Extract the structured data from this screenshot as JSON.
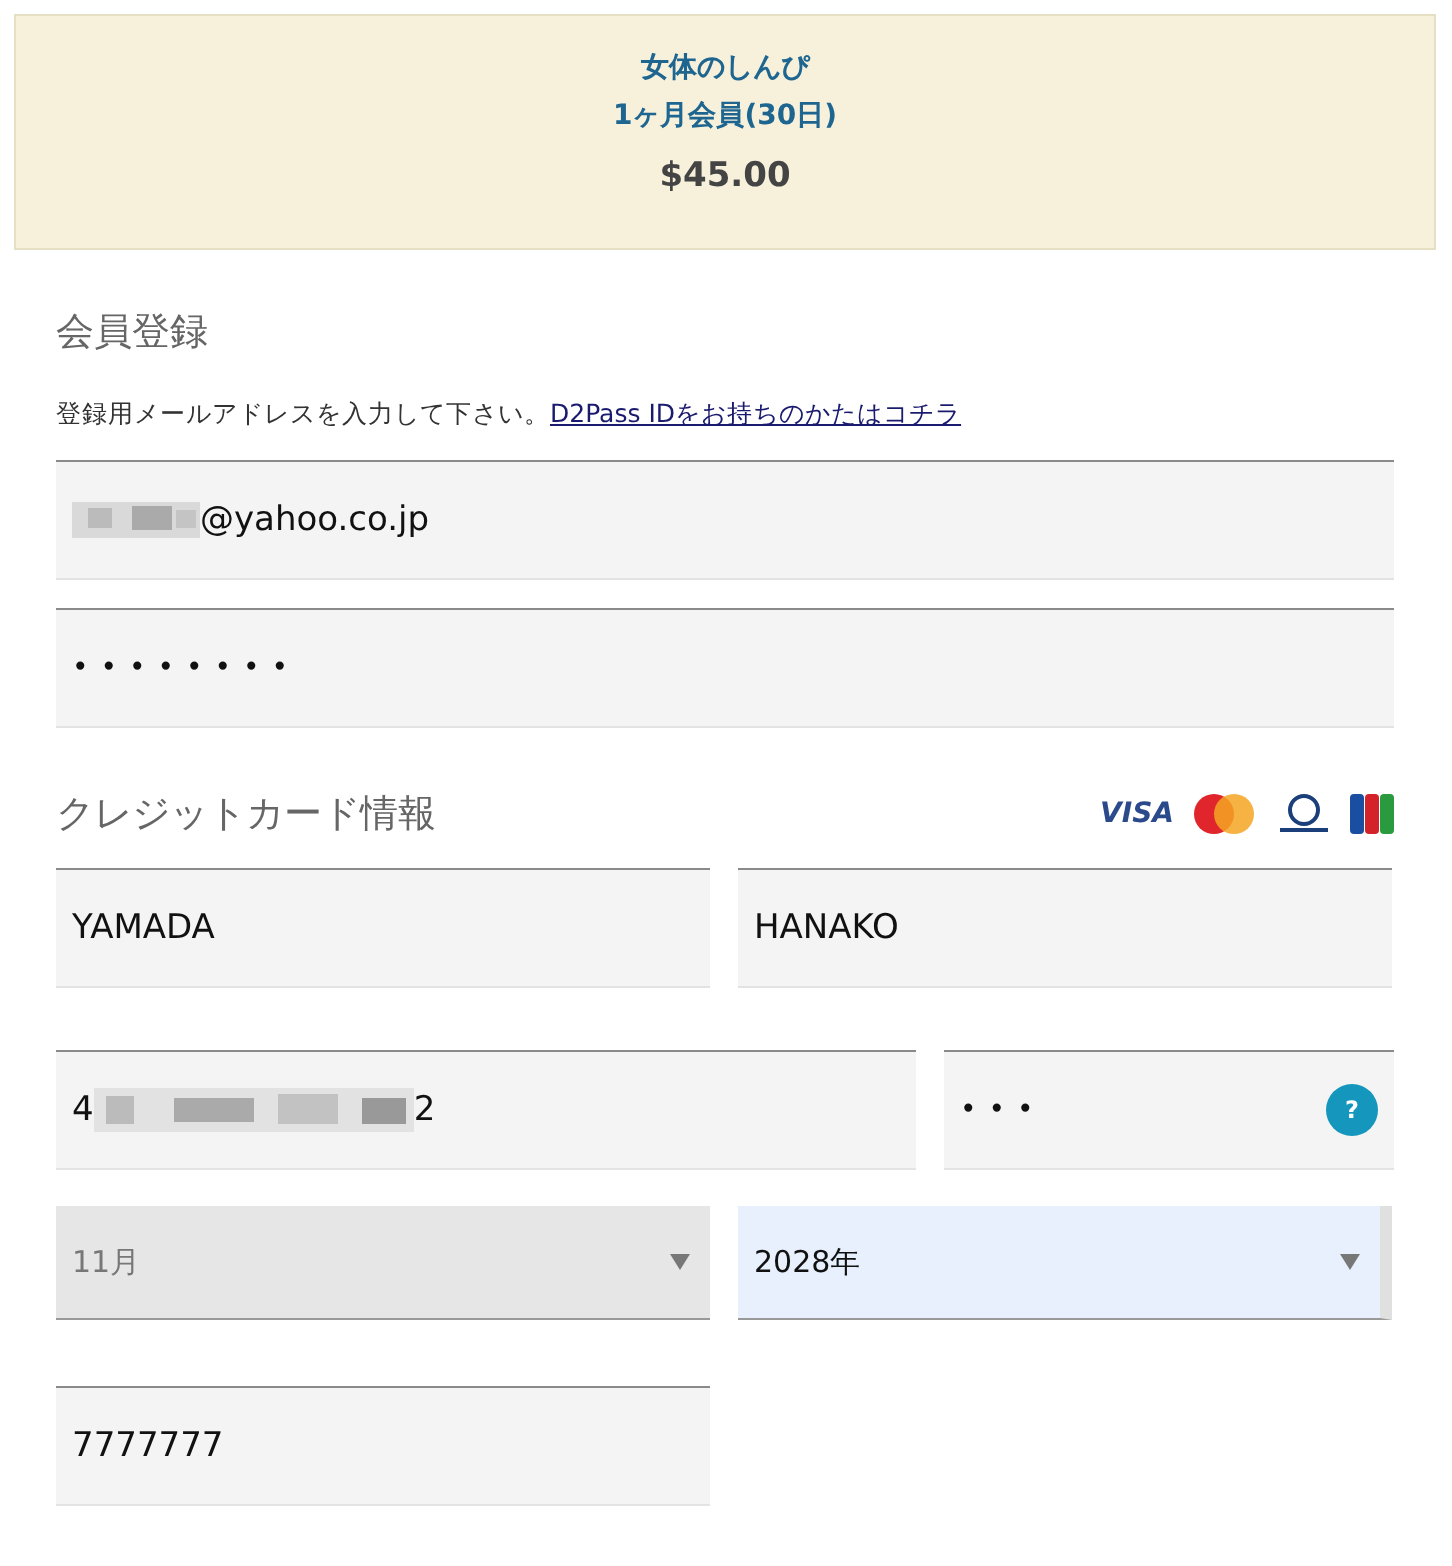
{
  "plan": {
    "title": "女体のしんぴ",
    "term": "1ヶ月会員(30日)",
    "price": "$45.00"
  },
  "registration": {
    "heading": "会員登録",
    "instruction": "登録用メールアドレスを入力して下さい。",
    "link": "D2Pass IDをお持ちのかたはコチラ",
    "email": {
      "value": "@yahoo.co.jp",
      "redacted": true
    },
    "password": {
      "value": "••••••••"
    }
  },
  "card": {
    "heading": "クレジットカード情報",
    "logos": [
      {
        "kind": "visa",
        "label": "VISA"
      },
      {
        "kind": "mastercard"
      },
      {
        "kind": "diners"
      },
      {
        "kind": "jcb"
      }
    ],
    "last_name": {
      "value": "YAMADA"
    },
    "first_name": {
      "value": "HANAKO"
    },
    "number": {
      "start": "4",
      "end": "2",
      "redacted": true
    },
    "cvc": {
      "value": "•••",
      "help": "?"
    },
    "month": {
      "value": "11月",
      "disabled": true,
      "highlighted": false
    },
    "year": {
      "value": "2028年",
      "disabled": false,
      "highlighted": true
    },
    "postal": {
      "value": "7777777"
    }
  }
}
